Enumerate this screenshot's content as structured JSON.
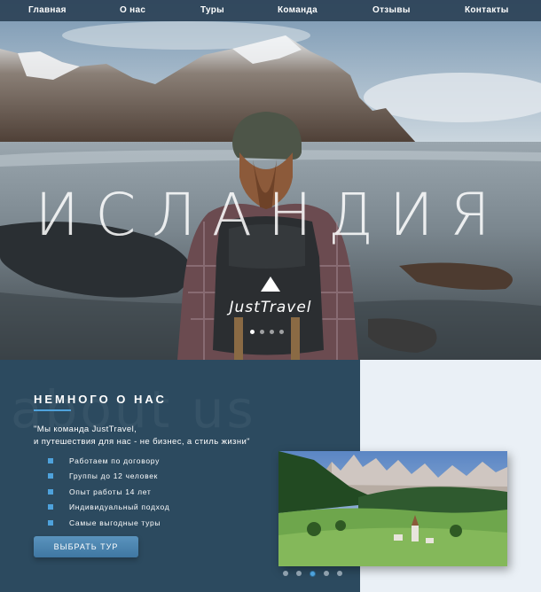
{
  "nav": {
    "items": [
      {
        "label": "Главная"
      },
      {
        "label": "О нас"
      },
      {
        "label": "Туры"
      },
      {
        "label": "Команда"
      },
      {
        "label": "Отзывы"
      },
      {
        "label": "Контакты"
      }
    ]
  },
  "hero": {
    "title": "ИСЛАНДИЯ",
    "logo_text": "JustTravel",
    "slides_count": 4,
    "active_slide": 1
  },
  "about": {
    "background_word": "about us",
    "title": "НЕМНОГО О НАС",
    "quote_line1": "\"Мы команда JustTravel,",
    "quote_line2": "и путешествия для нас - не бизнес, а стиль жизни\"",
    "features": [
      "Работаем по договору",
      "Группы до 12 человек",
      "Опыт работы 14 лет",
      "Индивидуальный подход",
      "Самые выгодные туры"
    ],
    "button_label": "ВЫБРАТЬ ТУР",
    "photo_slides_count": 5,
    "photo_active_slide": 3
  },
  "colors": {
    "nav_bg": "#283e52",
    "about_bg": "#2c4a5f",
    "accent": "#4ea2dc",
    "button": "#4a83ad"
  }
}
